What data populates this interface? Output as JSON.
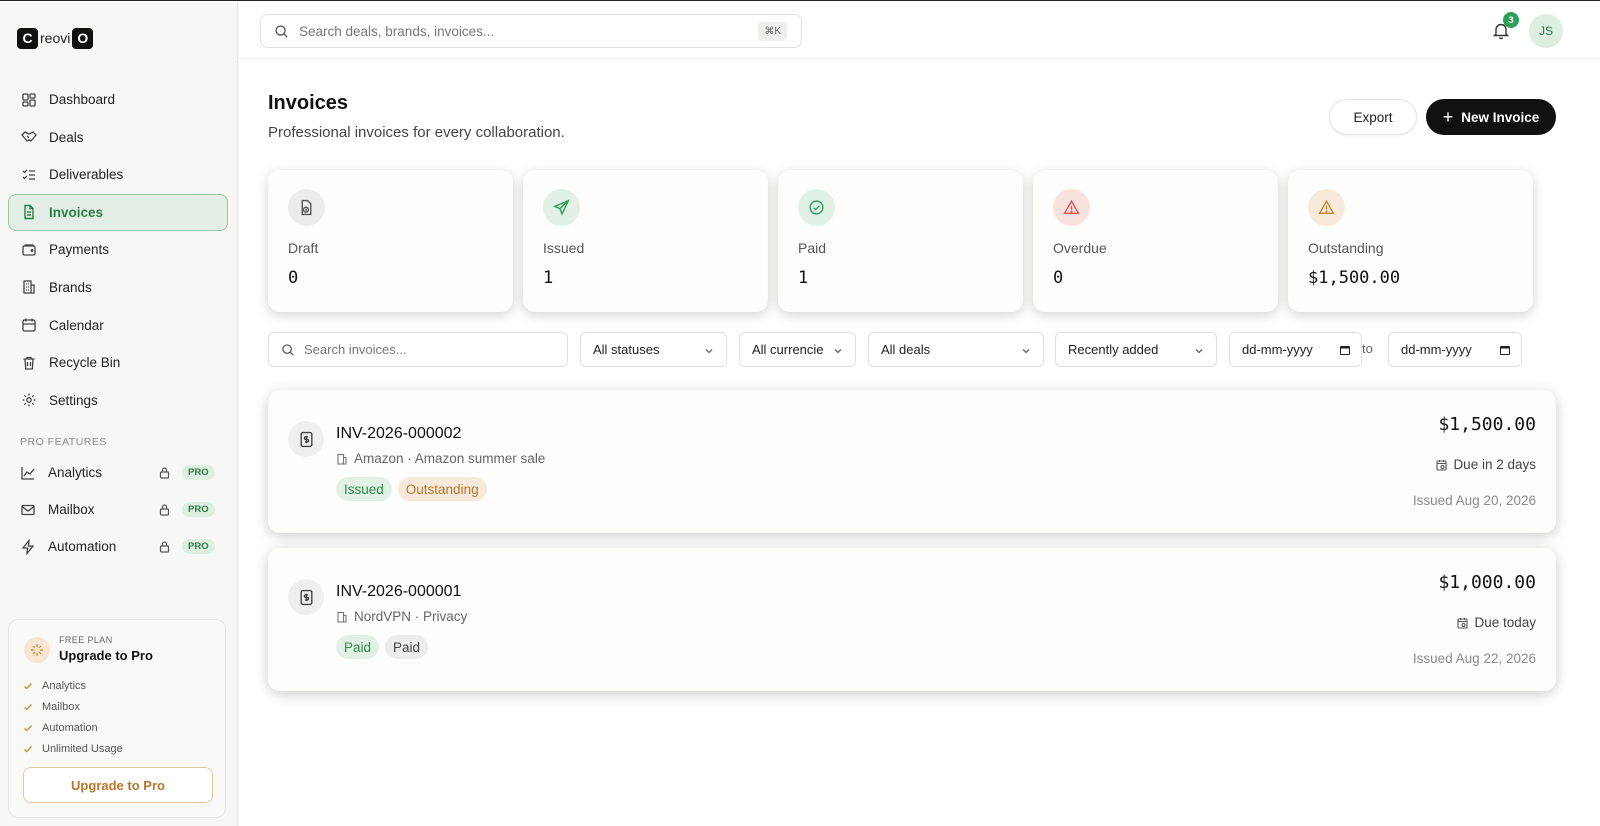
{
  "logo": {
    "left": "C",
    "mid": "reovi",
    "right": "O"
  },
  "sidebar": {
    "items": [
      {
        "label": "Dashboard",
        "icon": "dashboard-icon"
      },
      {
        "label": "Deals",
        "icon": "handshake-icon"
      },
      {
        "label": "Deliverables",
        "icon": "checklist-icon"
      },
      {
        "label": "Invoices",
        "icon": "document-icon",
        "active": true
      },
      {
        "label": "Payments",
        "icon": "wallet-icon"
      },
      {
        "label": "Brands",
        "icon": "building-icon"
      },
      {
        "label": "Calendar",
        "icon": "calendar-icon"
      },
      {
        "label": "Recycle Bin",
        "icon": "trash-icon"
      },
      {
        "label": "Settings",
        "icon": "gear-icon"
      }
    ],
    "pro_heading": "PRO FEATURES",
    "pro_items": [
      {
        "label": "Analytics",
        "badge": "PRO"
      },
      {
        "label": "Mailbox",
        "badge": "PRO"
      },
      {
        "label": "Automation",
        "badge": "PRO"
      }
    ],
    "upgrade": {
      "plan": "FREE PLAN",
      "title": "Upgrade to Pro",
      "features": [
        "Analytics",
        "Mailbox",
        "Automation",
        "Unlimited Usage"
      ],
      "button": "Upgrade to Pro"
    }
  },
  "topbar": {
    "search_placeholder": "Search deals, brands, invoices...",
    "shortcut": "⌘K",
    "notifications": "3",
    "avatar": "JS"
  },
  "page": {
    "title": "Invoices",
    "subtitle": "Professional invoices for every collaboration.",
    "export_label": "Export",
    "new_label": "New Invoice"
  },
  "stats": [
    {
      "label": "Draft",
      "value": "0",
      "color": "#6b6b6b"
    },
    {
      "label": "Issued",
      "value": "1",
      "color": "#2f9e5a"
    },
    {
      "label": "Paid",
      "value": "1",
      "color": "#2f9e5a"
    },
    {
      "label": "Overdue",
      "value": "0",
      "color": "#d9534f"
    },
    {
      "label": "Outstanding",
      "value": "$1,500.00",
      "color": "#c98a2e"
    }
  ],
  "filters": {
    "search_placeholder": "Search invoices...",
    "status": "All statuses",
    "currency": "All currencie",
    "deals": "All deals",
    "sort": "Recently added",
    "date_from": "dd-mm-yyyy",
    "to": "to",
    "date_to": "dd-mm-yyyy"
  },
  "invoices": [
    {
      "number": "INV-2026-000002",
      "meta": "Amazon · Amazon summer sale",
      "tags": [
        "Issued",
        "Outstanding"
      ],
      "amount": "$1,500.00",
      "due": "Due in 2 days",
      "issued": "Issued Aug 20, 2026"
    },
    {
      "number": "INV-2026-000001",
      "meta": "NordVPN · Privacy",
      "tags": [
        "Paid",
        "Paid"
      ],
      "amount": "$1,000.00",
      "due": "Due today",
      "issued": "Issued Aug 22, 2026"
    }
  ]
}
